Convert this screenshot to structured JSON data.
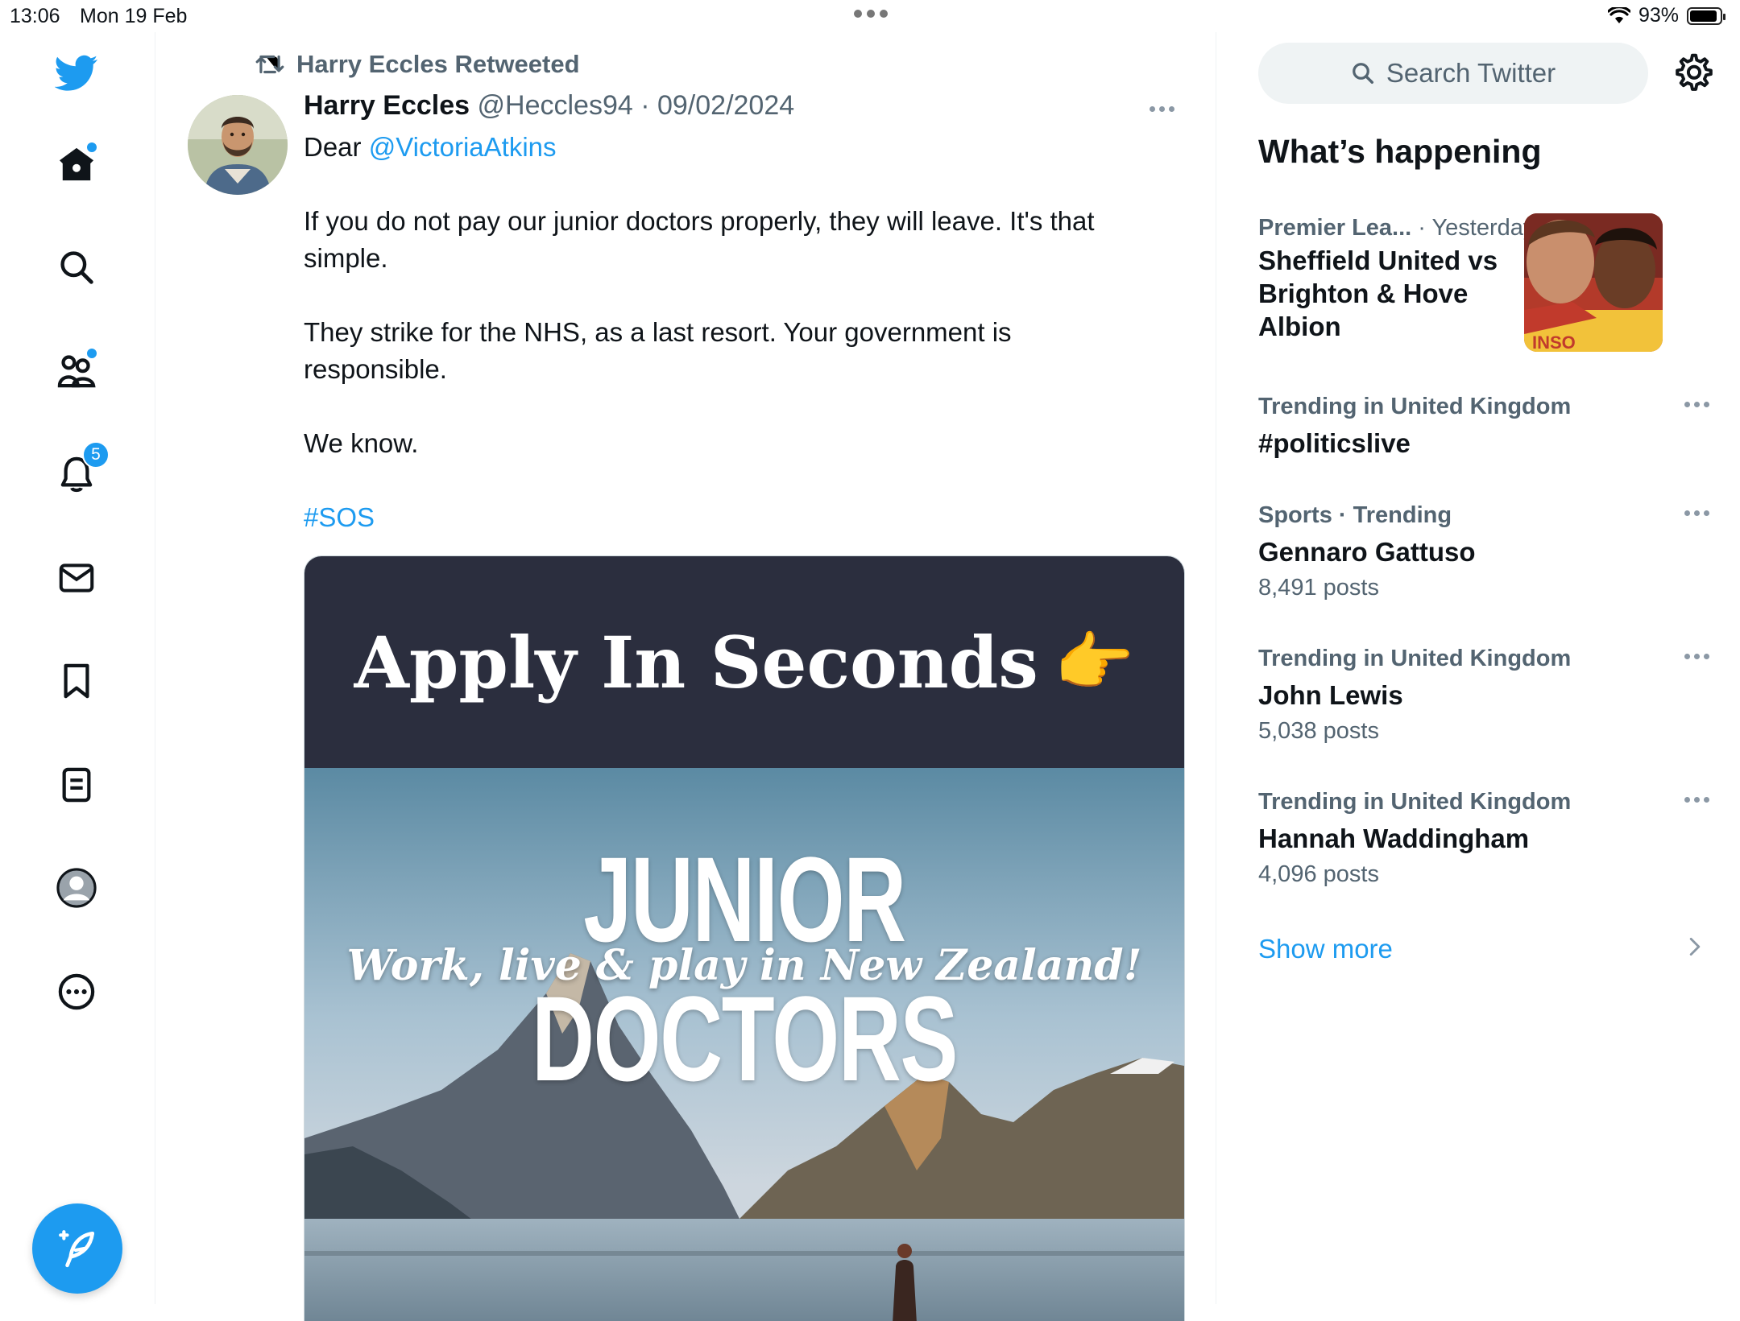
{
  "status_bar": {
    "time": "13:06",
    "date": "Mon 19 Feb",
    "battery": "93%",
    "battery_level": 0.93
  },
  "nav": {
    "items": [
      {
        "name": "twitter-logo-icon"
      },
      {
        "name": "home-icon",
        "dot": true
      },
      {
        "name": "search-icon"
      },
      {
        "name": "communities-icon",
        "dot": true
      },
      {
        "name": "notifications-icon",
        "badge": "5"
      },
      {
        "name": "messages-icon"
      },
      {
        "name": "bookmarks-icon"
      },
      {
        "name": "lists-icon"
      },
      {
        "name": "profile-icon"
      },
      {
        "name": "more-icon"
      }
    ],
    "notifications_badge": "5",
    "compose_icon": "compose-feather-icon"
  },
  "tweet": {
    "retweet_label": "Harry Eccles Retweeted",
    "author_name": "Harry Eccles",
    "author_handle": "@Heccles94",
    "separator": " · ",
    "date": "09/02/2024",
    "body_prefix": "Dear ",
    "mention": "@VictoriaAtkins",
    "paragraph_1": "If you do not pay our junior doctors properly, they will leave. It's that simple.",
    "paragraph_2": "They strike for the NHS, as a last resort. Your government is responsible.",
    "paragraph_3": "We know.",
    "hashtag": "#SOS",
    "media": {
      "banner": "Apply In Seconds",
      "banner_emoji": "👉",
      "headline": "JUNIOR DOCTORS",
      "tagline": "Work, live & play in New Zealand!"
    }
  },
  "sidebar": {
    "search_placeholder": "Search Twitter",
    "section_title": "What’s happening",
    "trends": [
      {
        "category": "Premier Lea...",
        "time": "· Yesterday",
        "title": "Sheffield United vs Brighton & Hove Albion",
        "count": ""
      },
      {
        "category": "Trending in United Kingdom",
        "time": "",
        "title": "#politicslive",
        "count": ""
      },
      {
        "category": "Sports · Trending",
        "time": "",
        "title": "Gennaro Gattuso",
        "count": "8,491 posts"
      },
      {
        "category": "Trending in United Kingdom",
        "time": "",
        "title": "John Lewis",
        "count": "5,038 posts"
      },
      {
        "category": "Trending in United Kingdom",
        "time": "",
        "title": "Hannah Waddingham",
        "count": "4,096 posts"
      }
    ],
    "show_more": "Show more"
  },
  "colors": {
    "accent": "#1d9bf0",
    "text_primary": "#0f1419",
    "text_secondary": "#536471",
    "media_banner": "#2b2e3e"
  }
}
